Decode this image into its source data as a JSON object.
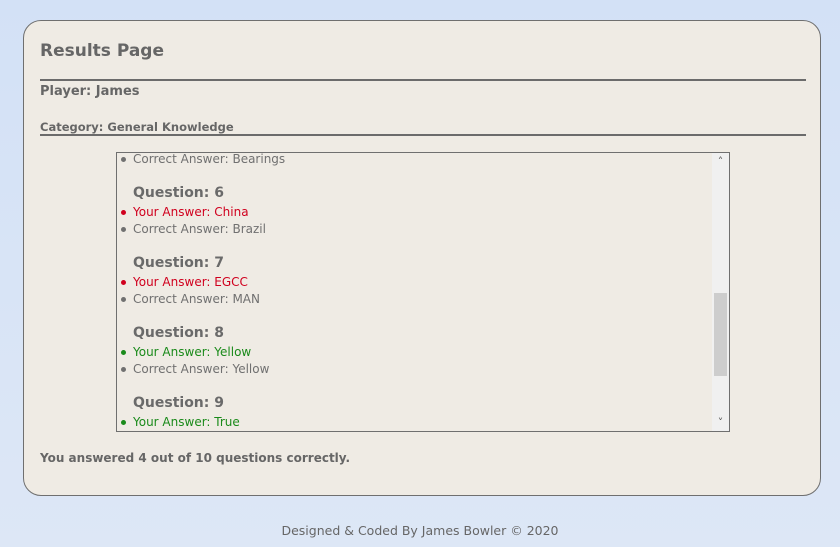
{
  "page": {
    "title": "Results Page",
    "player": "Player: James",
    "category": "Category: General Knowledge",
    "summary": "You answered 4 out of 10 questions correctly.",
    "footer": "Designed & Coded By James Bowler © 2020"
  },
  "results": {
    "top_line": "Correct Answer: Bearings",
    "questions": [
      {
        "heading": "Question: 6",
        "your_answer": "Your Answer: China",
        "correct_answer": "Correct Answer: Brazil",
        "status": "wrong"
      },
      {
        "heading": "Question: 7",
        "your_answer": "Your Answer: EGCC",
        "correct_answer": "Correct Answer: MAN",
        "status": "wrong"
      },
      {
        "heading": "Question: 8",
        "your_answer": "Your Answer: Yellow",
        "correct_answer": "Correct Answer: Yellow",
        "status": "right"
      },
      {
        "heading": "Question: 9",
        "your_answer": "Your Answer: True",
        "correct_answer": "",
        "status": "right"
      }
    ]
  },
  "icons": {
    "scroll_up": "chevron-up-icon",
    "scroll_down": "chevron-down-icon"
  },
  "colors": {
    "wrong": "#d0001e",
    "right": "#1a8a1a",
    "card_bg": "#efebe4"
  }
}
